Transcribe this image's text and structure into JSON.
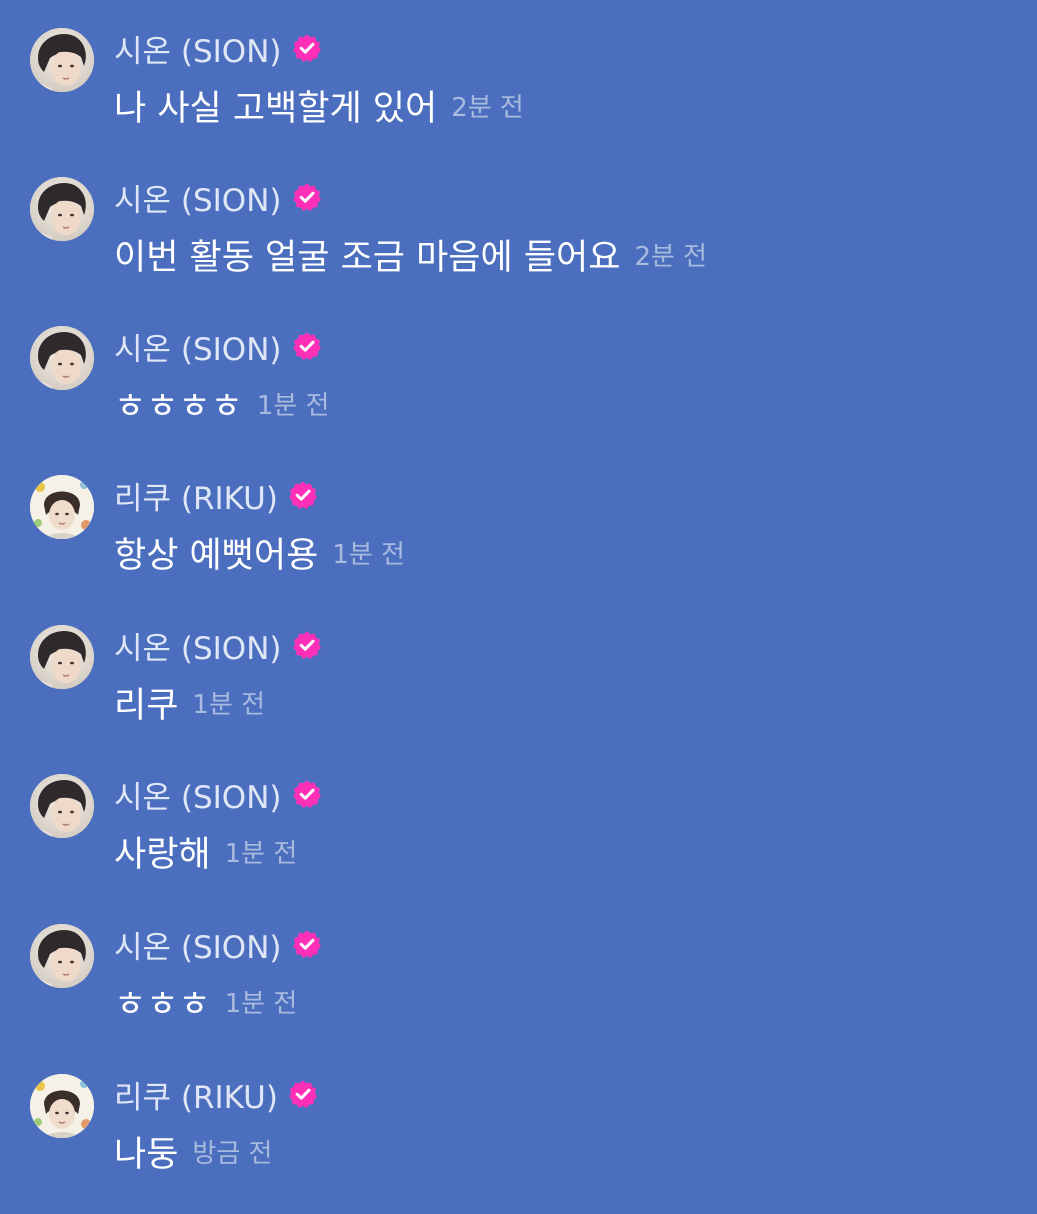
{
  "colors": {
    "background": "#4b6fbe",
    "name": "#dfe6f6",
    "message": "#ffffff",
    "timestamp": "#a9badf",
    "verified_badge": "#ff2fb8"
  },
  "messages": [
    {
      "author": "시온 (SION)",
      "avatar": "sion",
      "text": "나 사실 고백할게 있어",
      "time": "2분 전"
    },
    {
      "author": "시온 (SION)",
      "avatar": "sion",
      "text": "이번 활동 얼굴 조금 마음에 들어요",
      "time": "2분 전"
    },
    {
      "author": "시온 (SION)",
      "avatar": "sion",
      "text": "ㅎㅎㅎㅎ",
      "time": "1분 전"
    },
    {
      "author": "리쿠 (RIKU)",
      "avatar": "riku",
      "text": "항상 예뻣어용",
      "time": "1분 전"
    },
    {
      "author": "시온 (SION)",
      "avatar": "sion",
      "text": "리쿠",
      "time": "1분 전"
    },
    {
      "author": "시온 (SION)",
      "avatar": "sion",
      "text": "사랑해",
      "time": "1분 전"
    },
    {
      "author": "시온 (SION)",
      "avatar": "sion",
      "text": "ㅎㅎㅎ",
      "time": "1분 전"
    },
    {
      "author": "리쿠 (RIKU)",
      "avatar": "riku",
      "text": "나둥",
      "time": "방금 전"
    }
  ],
  "icons": {
    "avatar": "profile-photo",
    "badge": "verified-badge-icon"
  }
}
